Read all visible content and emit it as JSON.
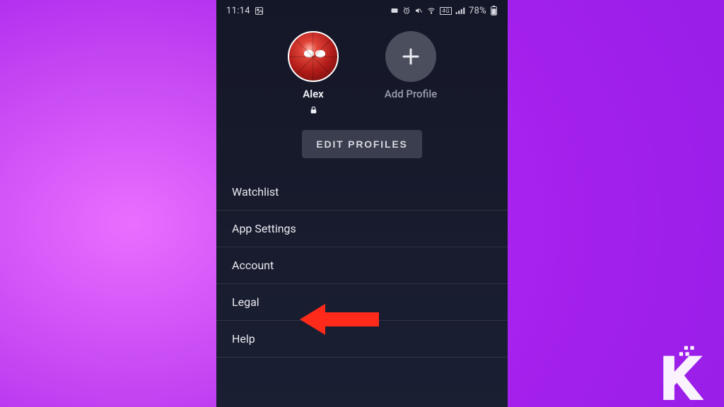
{
  "status_bar": {
    "time": "11:14",
    "battery_text": "78%"
  },
  "profiles": {
    "active": {
      "name": "Alex"
    },
    "add_label": "Add Profile"
  },
  "buttons": {
    "edit_profiles": "EDIT PROFILES"
  },
  "menu": {
    "items": [
      {
        "label": "Watchlist"
      },
      {
        "label": "App Settings"
      },
      {
        "label": "Account"
      },
      {
        "label": "Legal"
      },
      {
        "label": "Help"
      }
    ]
  },
  "annotation": {
    "target_menu_index": 2,
    "color": "#ff2a1a"
  }
}
